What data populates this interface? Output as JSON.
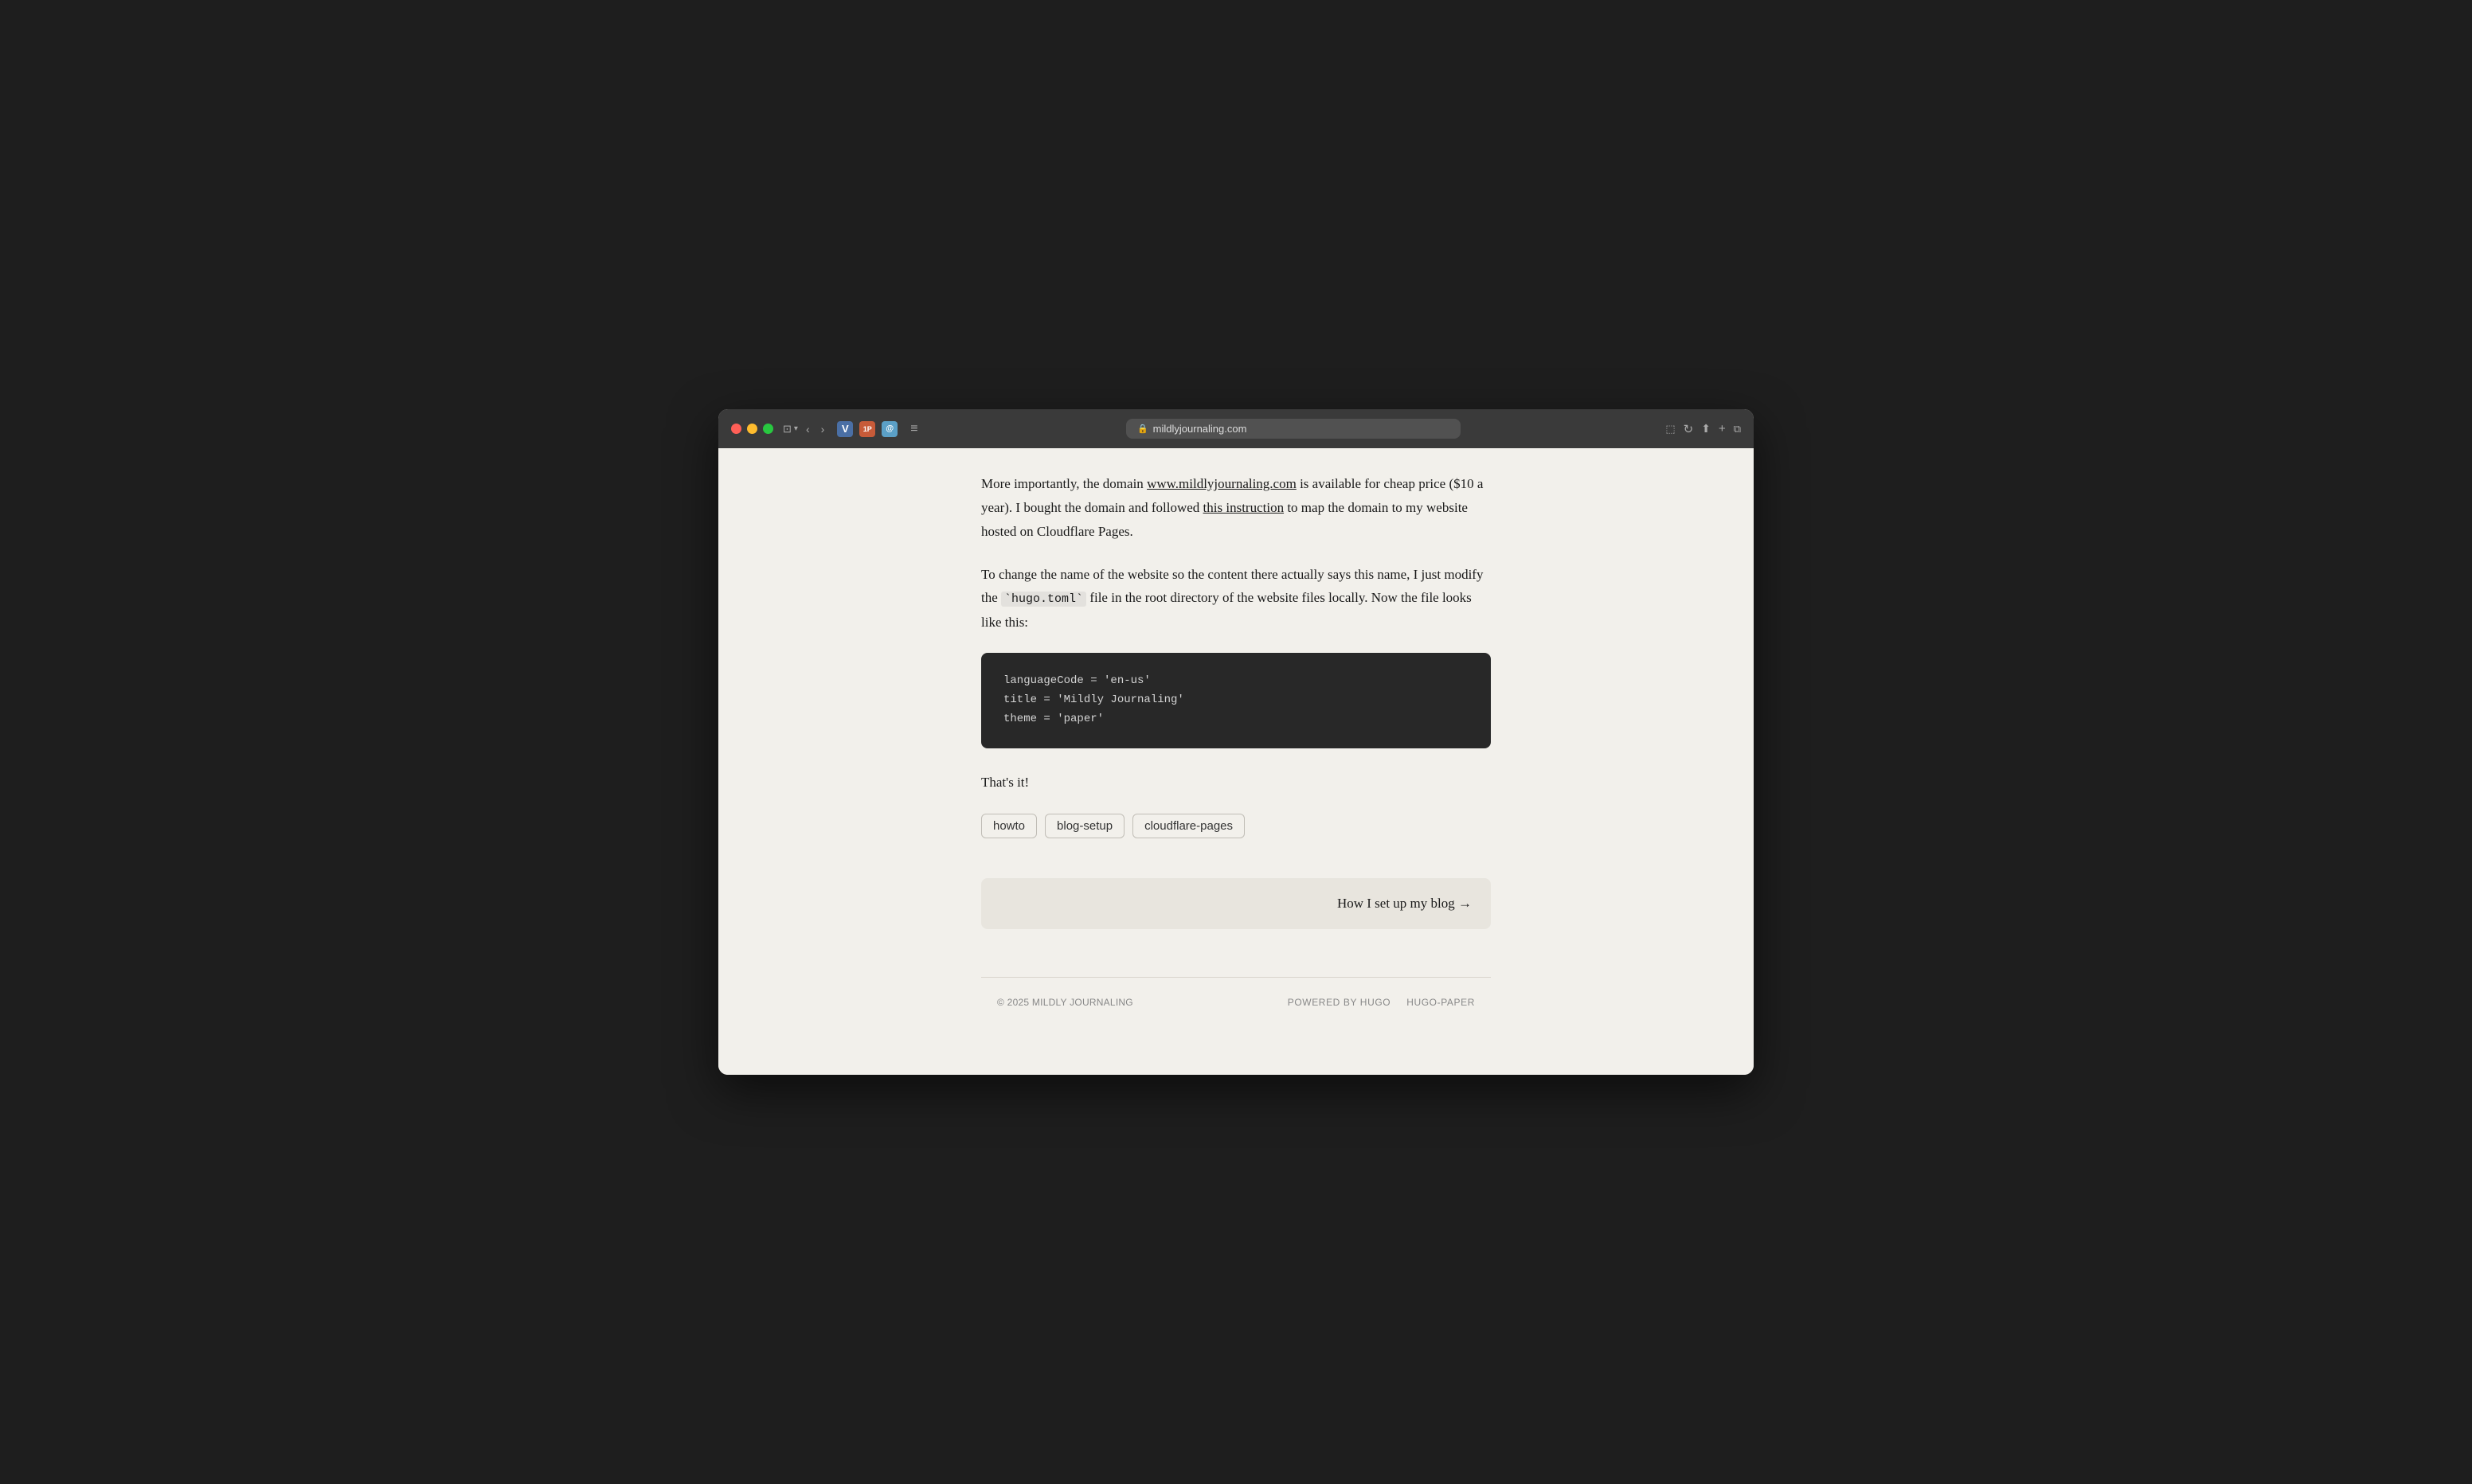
{
  "browser": {
    "url": "mildlyjournaling.com",
    "back_label": "‹",
    "forward_label": "›",
    "traffic_lights": [
      "red",
      "yellow",
      "green"
    ],
    "share_icon": "↑",
    "new_tab_icon": "+",
    "tabs_icon": "⧉",
    "reload_icon": "↻"
  },
  "article": {
    "paragraph1_part1": "More importantly, the domain ",
    "paragraph1_link": "www.mildlyjournaling.com",
    "paragraph1_part2": " is available for cheap price ($10 a year). I bought the domain and followed ",
    "paragraph1_instruction_link": "this instruction",
    "paragraph1_part3": " to map the domain to my website hosted on Cloudflare Pages.",
    "paragraph2_part1": "To change the name of the website so the content there actually says this name, I just modify the ",
    "paragraph2_code": "`hugo.toml`",
    "paragraph2_part2": " file in the root directory of the website files locally. Now the file looks like this:",
    "paragraph3": "That's it!",
    "code_lines": [
      "languageCode = 'en-us'",
      "title = 'Mildly Journaling'",
      "theme = 'paper'"
    ]
  },
  "tags": [
    {
      "label": "howto"
    },
    {
      "label": "blog-setup"
    },
    {
      "label": "cloudflare-pages"
    }
  ],
  "navigation": {
    "next_label": "How I set up my blog →"
  },
  "footer": {
    "copyright": "© 2025 MILDLY JOURNALING",
    "powered_by": "POWERED BY HUGO",
    "theme": "HUGO-PAPER"
  }
}
